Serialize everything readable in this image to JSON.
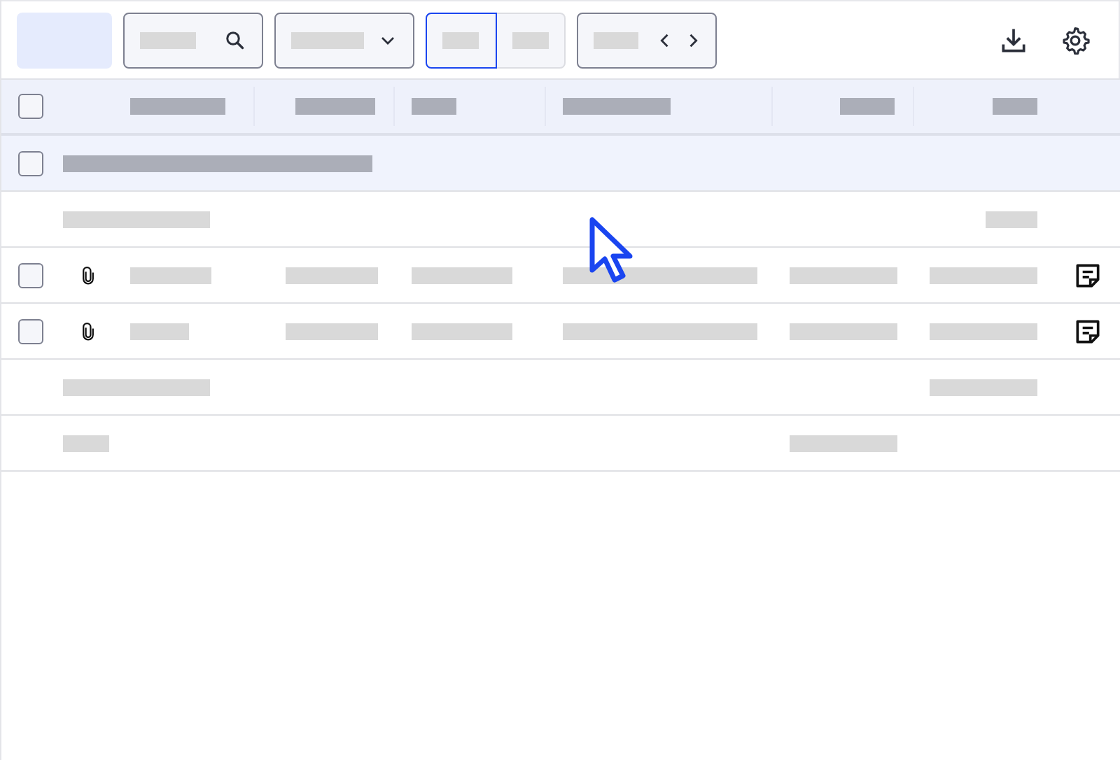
{
  "toolbar": {
    "view_toggle": [
      {
        "selected": true
      },
      {
        "selected": false
      }
    ]
  },
  "table": {
    "header": {
      "checked": false
    },
    "rows": [
      {
        "kind": "group",
        "checked": false
      },
      {
        "kind": "summary"
      },
      {
        "kind": "item",
        "checked": false,
        "attachment": true,
        "note": true
      },
      {
        "kind": "item",
        "checked": false,
        "attachment": true,
        "note": true
      },
      {
        "kind": "summary"
      },
      {
        "kind": "summary"
      }
    ]
  },
  "cursor": {
    "kind": "arrow"
  }
}
